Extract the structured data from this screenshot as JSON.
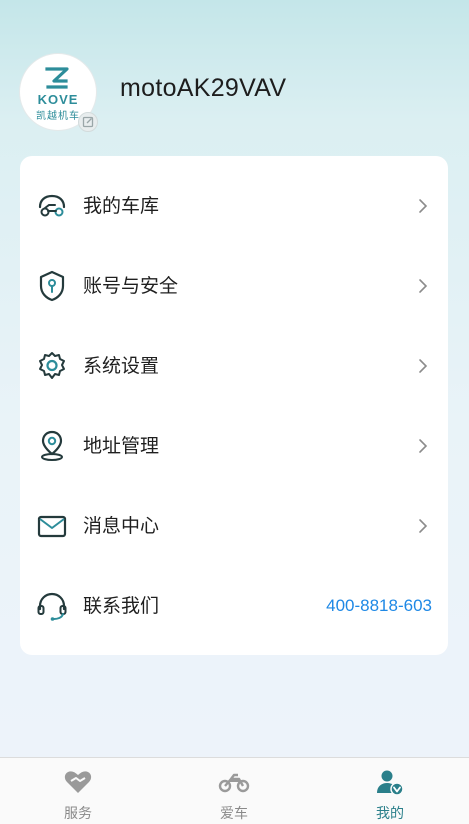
{
  "profile": {
    "avatar_brand": "KOVE",
    "avatar_brand_cn": "凯越机车",
    "username": "motoAK29VAV"
  },
  "menu": {
    "items": [
      {
        "label": "我的车库",
        "icon": "motorcycle-garage-icon"
      },
      {
        "label": "账号与安全",
        "icon": "shield-icon"
      },
      {
        "label": "系统设置",
        "icon": "gear-icon"
      },
      {
        "label": "地址管理",
        "icon": "location-pin-icon"
      },
      {
        "label": "消息中心",
        "icon": "envelope-icon"
      },
      {
        "label": "联系我们",
        "icon": "headset-icon",
        "value": "400-8818-603"
      }
    ]
  },
  "tabbar": {
    "tabs": [
      {
        "label": "服务",
        "icon": "heart-handshake-icon",
        "active": false
      },
      {
        "label": "爱车",
        "icon": "motorcycle-icon",
        "active": false
      },
      {
        "label": "我的",
        "icon": "user-verified-icon",
        "active": true
      }
    ]
  },
  "colors": {
    "accent": "#2a7f8a",
    "phone": "#1e88e5",
    "icon_stroke": "#243a3c"
  }
}
